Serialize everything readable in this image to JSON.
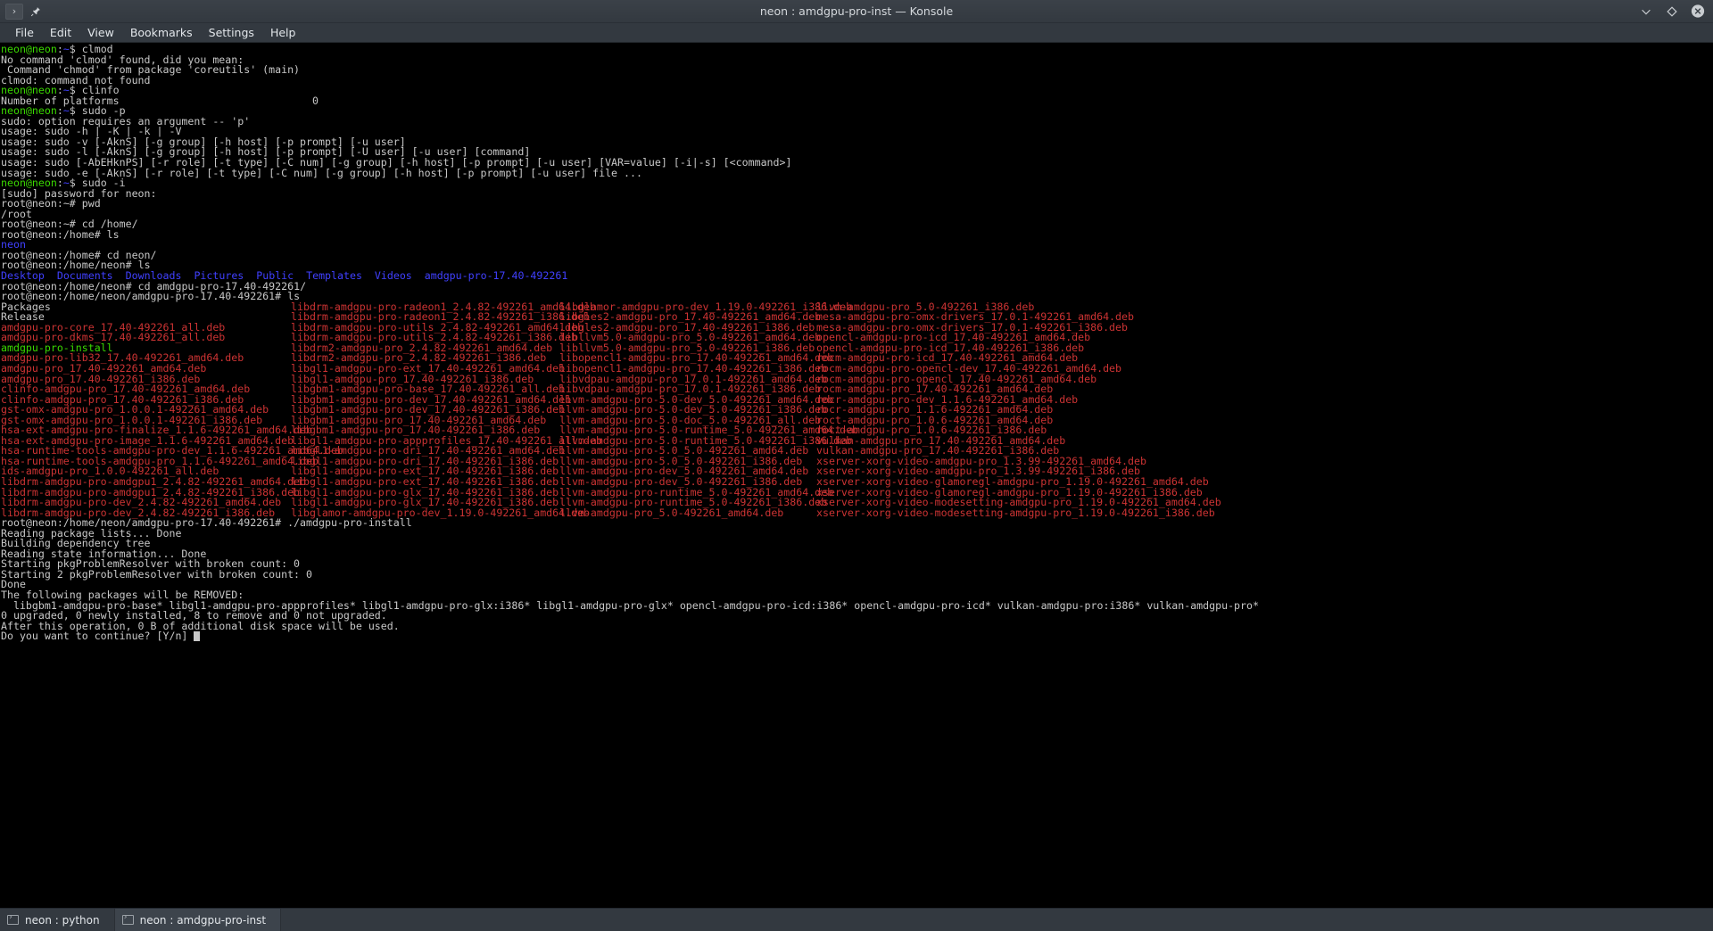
{
  "window": {
    "title": "neon : amdgpu-pro-inst — Konsole",
    "left_buttons": [
      {
        "name": "window-menu-button",
        "glyph": "›"
      },
      {
        "name": "pin-window-button",
        "glyph": "📌"
      }
    ],
    "controls": [
      {
        "name": "minimize-button",
        "glyph": "⌄"
      },
      {
        "name": "maximize-button",
        "glyph": "◇"
      },
      {
        "name": "close-button",
        "glyph": "✕"
      }
    ]
  },
  "menubar": {
    "items": [
      {
        "label": "File"
      },
      {
        "label": "Edit"
      },
      {
        "label": "View"
      },
      {
        "label": "Bookmarks"
      },
      {
        "label": "Settings"
      },
      {
        "label": "Help"
      }
    ]
  },
  "colors": {
    "background": "#000000",
    "foreground": "#c8c8c8",
    "prompt_green": "#3ad900",
    "dir_blue": "#4040ff",
    "archive_red": "#cc3333",
    "chrome": "#333940",
    "tab_active": "#3d444c"
  },
  "terminal": {
    "prompt_user": "neon@neon",
    "prompt_root": "root@neon",
    "lines": [
      "neon@neon:~$ clmod",
      "No command 'clmod' found, did you mean:",
      " Command 'chmod' from package 'coreutils' (main)",
      "clmod: command not found",
      "neon@neon:~$ clinfo",
      "Number of platforms                               0",
      "neon@neon:~$ sudo -p",
      "sudo: option requires an argument -- 'p'",
      "usage: sudo -h | -K | -k | -V",
      "usage: sudo -v [-AknS] [-g group] [-h host] [-p prompt] [-u user]",
      "usage: sudo -l [-AknS] [-g group] [-h host] [-p prompt] [-U user] [-u user] [command]",
      "usage: sudo [-AbEHknPS] [-r role] [-t type] [-C num] [-g group] [-h host] [-p prompt] [-u user] [VAR=value] [-i|-s] [<command>]",
      "usage: sudo -e [-AknS] [-r role] [-t type] [-C num] [-g group] [-h host] [-p prompt] [-u user] file ...",
      "neon@neon:~$ sudo -i",
      "[sudo] password for neon:",
      "root@neon:~# pwd",
      "/root",
      "root@neon:~# cd /home/",
      "root@neon:/home# ls",
      "neon",
      "root@neon:/home# cd neon/",
      "root@neon:/home/neon# ls",
      "Desktop  Documents  Downloads  Pictures  Public  Templates  Videos  amdgpu-pro-17.40-492261",
      "root@neon:/home/neon# cd amdgpu-pro-17.40-492261/",
      "root@neon:/home/neon/amdgpu-pro-17.40-492261# ls"
    ],
    "home_dirs": [
      "Desktop",
      "Documents",
      "Downloads",
      "Pictures",
      "Public",
      "Templates",
      "Videos",
      "amdgpu-pro-17.40-492261"
    ],
    "ls_rows": [
      [
        {
          "t": "Packages",
          "c": "w"
        },
        {
          "t": "libdrm-amdgpu-pro-radeon1_2.4.82-492261_amd64.deb",
          "c": "r"
        },
        {
          "t": "libglamor-amdgpu-pro-dev_1.19.0-492261_i386.deb",
          "c": "r"
        },
        {
          "t": "llvm-amdgpu-pro_5.0-492261_i386.deb",
          "c": "r"
        }
      ],
      [
        {
          "t": "Release",
          "c": "w"
        },
        {
          "t": "libdrm-amdgpu-pro-radeon1_2.4.82-492261_i386.deb",
          "c": "r"
        },
        {
          "t": "libgles2-amdgpu-pro_17.40-492261_amd64.deb",
          "c": "r"
        },
        {
          "t": "mesa-amdgpu-pro-omx-drivers_17.0.1-492261_amd64.deb",
          "c": "r"
        }
      ],
      [
        {
          "t": "amdgpu-pro-core_17.40-492261_all.deb",
          "c": "r"
        },
        {
          "t": "libdrm-amdgpu-pro-utils_2.4.82-492261_amd64.deb",
          "c": "r"
        },
        {
          "t": "libgles2-amdgpu-pro_17.40-492261_i386.deb",
          "c": "r"
        },
        {
          "t": "mesa-amdgpu-pro-omx-drivers_17.0.1-492261_i386.deb",
          "c": "r"
        }
      ],
      [
        {
          "t": "amdgpu-pro-dkms_17.40-492261_all.deb",
          "c": "r"
        },
        {
          "t": "libdrm-amdgpu-pro-utils_2.4.82-492261_i386.deb",
          "c": "r"
        },
        {
          "t": "libllvm5.0-amdgpu-pro_5.0-492261_amd64.deb",
          "c": "r"
        },
        {
          "t": "opencl-amdgpu-pro-icd_17.40-492261_amd64.deb",
          "c": "r"
        }
      ],
      [
        {
          "t": "amdgpu-pro-install",
          "c": "g"
        },
        {
          "t": "libdrm2-amdgpu-pro_2.4.82-492261_amd64.deb",
          "c": "r"
        },
        {
          "t": "libllvm5.0-amdgpu-pro_5.0-492261_i386.deb",
          "c": "r"
        },
        {
          "t": "opencl-amdgpu-pro-icd_17.40-492261_i386.deb",
          "c": "r"
        }
      ],
      [
        {
          "t": "amdgpu-pro-lib32_17.40-492261_amd64.deb",
          "c": "r"
        },
        {
          "t": "libdrm2-amdgpu-pro_2.4.82-492261_i386.deb",
          "c": "r"
        },
        {
          "t": "libopencl1-amdgpu-pro_17.40-492261_amd64.deb",
          "c": "r"
        },
        {
          "t": "rocm-amdgpu-pro-icd_17.40-492261_amd64.deb",
          "c": "r"
        }
      ],
      [
        {
          "t": "amdgpu-pro_17.40-492261_amd64.deb",
          "c": "r"
        },
        {
          "t": "libgl1-amdgpu-pro-ext_17.40-492261_amd64.deb",
          "c": "r"
        },
        {
          "t": "libopencl1-amdgpu-pro_17.40-492261_i386.deb",
          "c": "r"
        },
        {
          "t": "rocm-amdgpu-pro-opencl-dev_17.40-492261_amd64.deb",
          "c": "r"
        }
      ],
      [
        {
          "t": "amdgpu-pro_17.40-492261_i386.deb",
          "c": "r"
        },
        {
          "t": "libgl1-amdgpu-pro_17.40-492261_i386.deb",
          "c": "r"
        },
        {
          "t": "libvdpau-amdgpu-pro_17.0.1-492261_amd64.deb",
          "c": "r"
        },
        {
          "t": "rocm-amdgpu-pro-opencl_17.40-492261_amd64.deb",
          "c": "r"
        }
      ],
      [
        {
          "t": "clinfo-amdgpu-pro_17.40-492261_amd64.deb",
          "c": "r"
        },
        {
          "t": "libgbm1-amdgpu-pro-base_17.40-492261_all.deb",
          "c": "r"
        },
        {
          "t": "libvdpau-amdgpu-pro_17.0.1-492261_i386.deb",
          "c": "r"
        },
        {
          "t": "rocm-amdgpu-pro_17.40-492261_amd64.deb",
          "c": "r"
        }
      ],
      [
        {
          "t": "clinfo-amdgpu-pro_17.40-492261_i386.deb",
          "c": "r"
        },
        {
          "t": "libgbm1-amdgpu-pro-dev_17.40-492261_amd64.deb",
          "c": "r"
        },
        {
          "t": "llvm-amdgpu-pro-5.0-dev_5.0-492261_amd64.deb",
          "c": "r"
        },
        {
          "t": "rocr-amdgpu-pro-dev_1.1.6-492261_amd64.deb",
          "c": "r"
        }
      ],
      [
        {
          "t": "gst-omx-amdgpu-pro_1.0.0.1-492261_amd64.deb",
          "c": "r"
        },
        {
          "t": "libgbm1-amdgpu-pro-dev_17.40-492261_i386.deb",
          "c": "r"
        },
        {
          "t": "llvm-amdgpu-pro-5.0-dev_5.0-492261_i386.deb",
          "c": "r"
        },
        {
          "t": "rocr-amdgpu-pro_1.1.6-492261_amd64.deb",
          "c": "r"
        }
      ],
      [
        {
          "t": "gst-omx-amdgpu-pro_1.0.0.1-492261_i386.deb",
          "c": "r"
        },
        {
          "t": "libgbm1-amdgpu-pro_17.40-492261_amd64.deb",
          "c": "r"
        },
        {
          "t": "llvm-amdgpu-pro-5.0-doc_5.0-492261_all.deb",
          "c": "r"
        },
        {
          "t": "roct-amdgpu-pro_1.0.6-492261_amd64.deb",
          "c": "r"
        }
      ],
      [
        {
          "t": "hsa-ext-amdgpu-pro-finalize_1.1.6-492261_amd64.deb",
          "c": "r"
        },
        {
          "t": "libgbm1-amdgpu-pro_17.40-492261_i386.deb",
          "c": "r"
        },
        {
          "t": "llvm-amdgpu-pro-5.0-runtime_5.0-492261_amd64.deb",
          "c": "r"
        },
        {
          "t": "roct-amdgpu-pro_1.0.6-492261_i386.deb",
          "c": "r"
        }
      ],
      [
        {
          "t": "hsa-ext-amdgpu-pro-image_1.1.6-492261_amd64.deb",
          "c": "r"
        },
        {
          "t": "libgl1-amdgpu-pro-appprofiles_17.40-492261_all.deb",
          "c": "r"
        },
        {
          "t": "llvm-amdgpu-pro-5.0-runtime_5.0-492261_i386.deb",
          "c": "r"
        },
        {
          "t": "vulkan-amdgpu-pro_17.40-492261_amd64.deb",
          "c": "r"
        }
      ],
      [
        {
          "t": "hsa-runtime-tools-amdgpu-pro-dev_1.1.6-492261_amd64.deb",
          "c": "r"
        },
        {
          "t": "libgl1-amdgpu-pro-dri_17.40-492261_amd64.deb",
          "c": "r"
        },
        {
          "t": "llvm-amdgpu-pro-5.0_5.0-492261_amd64.deb",
          "c": "r"
        },
        {
          "t": "vulkan-amdgpu-pro_17.40-492261_i386.deb",
          "c": "r"
        }
      ],
      [
        {
          "t": "hsa-runtime-tools-amdgpu-pro_1.1.6-492261_amd64.deb",
          "c": "r"
        },
        {
          "t": "libgl1-amdgpu-pro-dri_17.40-492261_i386.deb",
          "c": "r"
        },
        {
          "t": "llvm-amdgpu-pro-5.0_5.0-492261_i386.deb",
          "c": "r"
        },
        {
          "t": "xserver-xorg-video-amdgpu-pro_1.3.99-492261_amd64.deb",
          "c": "r"
        }
      ],
      [
        {
          "t": "ids-amdgpu-pro_1.0.0-492261_all.deb",
          "c": "r"
        },
        {
          "t": "libgl1-amdgpu-pro-ext_17.40-492261_i386.deb",
          "c": "r"
        },
        {
          "t": "llvm-amdgpu-pro-dev_5.0-492261_amd64.deb",
          "c": "r"
        },
        {
          "t": "xserver-xorg-video-amdgpu-pro_1.3.99-492261_i386.deb",
          "c": "r"
        }
      ],
      [
        {
          "t": "libdrm-amdgpu-pro-amdgpu1_2.4.82-492261_amd64.deb",
          "c": "r"
        },
        {
          "t": "libgl1-amdgpu-pro-ext_17.40-492261_i386.deb",
          "c": "r"
        },
        {
          "t": "llvm-amdgpu-pro-dev_5.0-492261_i386.deb",
          "c": "r"
        },
        {
          "t": "xserver-xorg-video-glamoregl-amdgpu-pro_1.19.0-492261_amd64.deb",
          "c": "r"
        }
      ],
      [
        {
          "t": "libdrm-amdgpu-pro-amdgpu1_2.4.82-492261_i386.deb",
          "c": "r"
        },
        {
          "t": "libgl1-amdgpu-pro-glx_17.40-492261_i386.deb",
          "c": "r"
        },
        {
          "t": "llvm-amdgpu-pro-runtime_5.0-492261_amd64.deb",
          "c": "r"
        },
        {
          "t": "xserver-xorg-video-glamoregl-amdgpu-pro_1.19.0-492261_i386.deb",
          "c": "r"
        }
      ],
      [
        {
          "t": "libdrm-amdgpu-pro-dev_2.4.82-492261_amd64.deb",
          "c": "r"
        },
        {
          "t": "libgl1-amdgpu-pro-glx_17.40-492261_i386.deb",
          "c": "r"
        },
        {
          "t": "llvm-amdgpu-pro-runtime_5.0-492261_i386.deb",
          "c": "r"
        },
        {
          "t": "xserver-xorg-video-modesetting-amdgpu-pro_1.19.0-492261_amd64.deb",
          "c": "r"
        }
      ],
      [
        {
          "t": "libdrm-amdgpu-pro-dev_2.4.82-492261_i386.deb",
          "c": "r"
        },
        {
          "t": "libglamor-amdgpu-pro-dev_1.19.0-492261_amd64.deb",
          "c": "r"
        },
        {
          "t": "llvm-amdgpu-pro_5.0-492261_amd64.deb",
          "c": "r"
        },
        {
          "t": "xserver-xorg-video-modesetting-amdgpu-pro_1.19.0-492261_i386.deb",
          "c": "r"
        }
      ]
    ],
    "tail_lines": [
      "root@neon:/home/neon/amdgpu-pro-17.40-492261# ./amdgpu-pro-install",
      "Reading package lists... Done",
      "Building dependency tree",
      "Reading state information... Done",
      "Starting pkgProblemResolver with broken count: 0",
      "Starting 2 pkgProblemResolver with broken count: 0",
      "Done",
      "The following packages will be REMOVED:",
      "  libgbm1-amdgpu-pro-base* libgl1-amdgpu-pro-appprofiles* libgl1-amdgpu-pro-glx:i386* libgl1-amdgpu-pro-glx* opencl-amdgpu-pro-icd:i386* opencl-amdgpu-pro-icd* vulkan-amdgpu-pro:i386* vulkan-amdgpu-pro*",
      "0 upgraded, 0 newly installed, 8 to remove and 0 not upgraded.",
      "After this operation, 0 B of additional disk space will be used.",
      "Do you want to continue? [Y/n]"
    ]
  },
  "tabs": [
    {
      "label": "neon : python",
      "active": false
    },
    {
      "label": "neon : amdgpu-pro-inst",
      "active": true
    }
  ]
}
